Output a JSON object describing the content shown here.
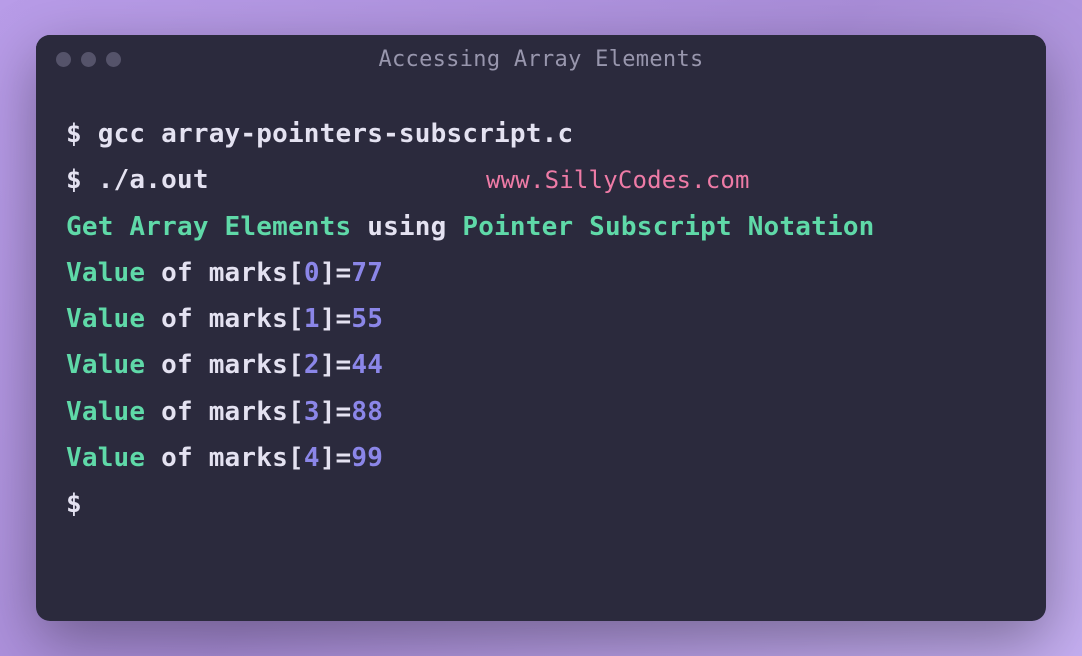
{
  "window": {
    "title": "Accessing Array Elements"
  },
  "watermark": "www.SillyCodes.com",
  "terminal": {
    "prompt": "$",
    "commands": [
      "gcc array-pointers-subscript.c",
      "./a.out"
    ],
    "header": {
      "part1": "Get",
      "part2": " Array Elements ",
      "part3": "using ",
      "part4": "Pointer Subscript Notation"
    },
    "lines": [
      {
        "prefix": "Value",
        "of": " of ",
        "arr": "marks[",
        "idx": "0",
        "close": "]=",
        "val": "77"
      },
      {
        "prefix": "Value",
        "of": " of ",
        "arr": "marks[",
        "idx": "1",
        "close": "]=",
        "val": "55"
      },
      {
        "prefix": "Value",
        "of": " of ",
        "arr": "marks[",
        "idx": "2",
        "close": "]=",
        "val": "44"
      },
      {
        "prefix": "Value",
        "of": " of ",
        "arr": "marks[",
        "idx": "3",
        "close": "]=",
        "val": "88"
      },
      {
        "prefix": "Value",
        "of": " of ",
        "arr": "marks[",
        "idx": "4",
        "close": "]=",
        "val": "99"
      }
    ]
  }
}
